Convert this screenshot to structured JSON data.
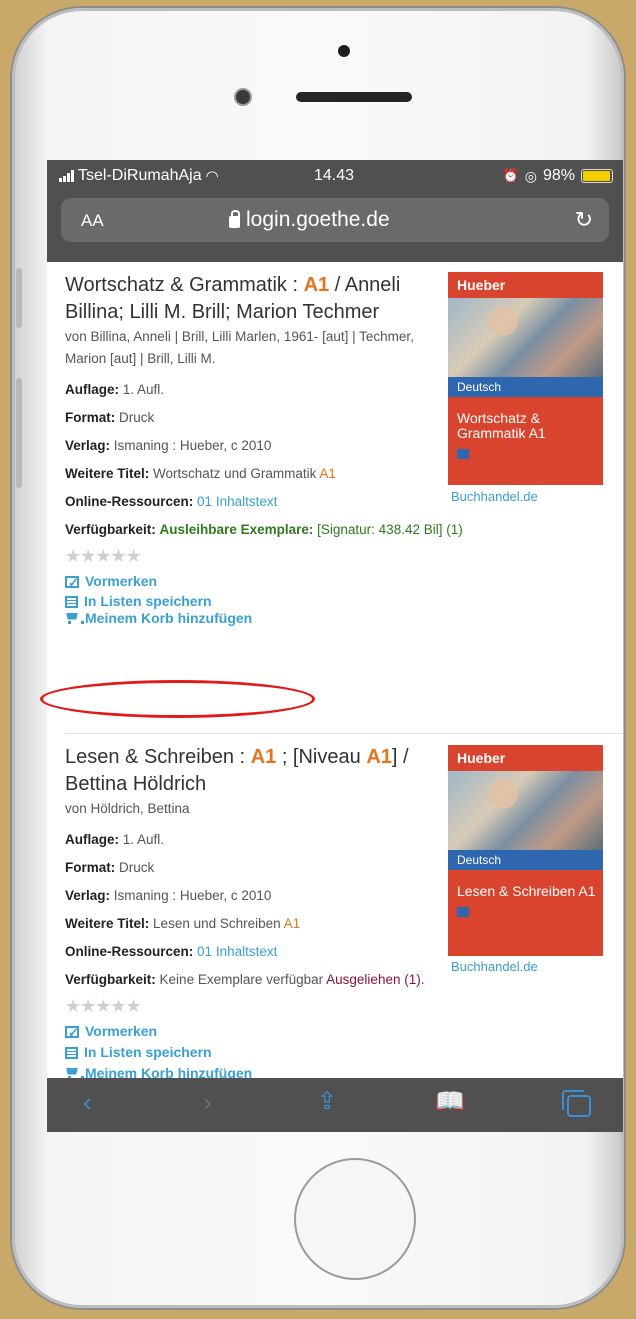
{
  "status_bar": {
    "carrier": "Tsel-DiRumahAja",
    "time": "14.43",
    "battery": "98%",
    "battery_level": 0.98
  },
  "address_bar": {
    "text_size_label": "AA",
    "url": "login.goethe.de"
  },
  "records": [
    {
      "title_part1": "Wortschatz & Grammatik : ",
      "title_hl": "A1",
      "title_part2": " / Anneli Billina; Lilli M. Brill; Marion Techmer",
      "author": "von Billina, Anneli | Brill, Lilli Marlen, 1961- [aut] | Techmer, Marion [aut] | Brill, Lilli M.",
      "auflage_label": "Auflage:",
      "auflage": "1. Aufl.",
      "format_label": "Format:",
      "format": "Druck",
      "verlag_label": "Verlag:",
      "verlag": "Ismaning : Hueber, c 2010",
      "weitere_label": "Weitere Titel:",
      "weitere": "Wortschatz und Grammatik",
      "weitere_hl": "A1",
      "online_label": "Online-Ressourcen:",
      "online_link": "01 Inhaltstext",
      "verf_label": "Verfügbarkeit:",
      "verf_status": "Ausleihbare Exemplare:",
      "verf_detail": "[Signatur: 438.42 Bil] (1)",
      "actions": [
        "Vormerken",
        "In Listen speichern",
        "Meinem Korb hinzufügen"
      ],
      "cover": {
        "brand": "Hueber",
        "band": "Deutsch",
        "title": "Wortschatz & Grammatik A1"
      },
      "shop_link": "Buchhandel.de"
    },
    {
      "title_part1": "Lesen & Schreiben : ",
      "title_hl": "A1",
      "title_part2": " ; [Niveau ",
      "title_hl2": "A1",
      "title_part3": "] / Bettina Höldrich",
      "author": "von Höldrich, Bettina",
      "auflage_label": "Auflage:",
      "auflage": "1. Aufl.",
      "format_label": "Format:",
      "format": "Druck",
      "verlag_label": "Verlag:",
      "verlag": "Ismaning : Hueber, c 2010",
      "weitere_label": "Weitere Titel:",
      "weitere": "Lesen und Schreiben",
      "weitere_hl": "A1",
      "online_label": "Online-Ressourcen:",
      "online_link": "01 Inhaltstext",
      "verf_label": "Verfügbarkeit:",
      "verf_detail": "Keine Exemplare verfügbar",
      "verf_status": "Ausgeliehen (1).",
      "actions": [
        "Vormerken",
        "In Listen speichern",
        "Meinem Korb hinzufügen"
      ],
      "cover": {
        "brand": "Hueber",
        "band": "Deutsch",
        "title": "Lesen & Schreiben A1"
      },
      "shop_link": "Buchhandel.de"
    }
  ],
  "colors": {
    "highlight": "#e8731a",
    "link": "#3aa0d0",
    "available": "#2f7a1d",
    "loaned": "#8b1538",
    "annotation": "#e01b1b"
  }
}
